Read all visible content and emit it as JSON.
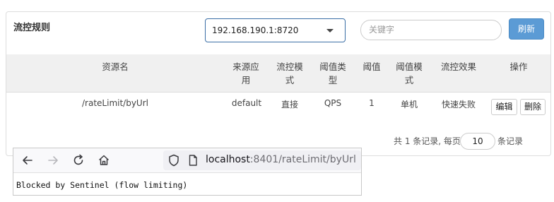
{
  "panel": {
    "title": "流控规则",
    "machine_select": "192.168.190.1:8720",
    "search_placeholder": "关键字",
    "refresh_label": "刷新"
  },
  "table": {
    "headers": [
      "资源名",
      "来源应用",
      "流控模式",
      "阈值类型",
      "阈值",
      "阈值模式",
      "流控效果",
      "操作"
    ],
    "headers_wrapped": {
      "source_app": [
        "来源应",
        "用"
      ],
      "flow_mode": [
        "流控模",
        "式"
      ],
      "threshold_type": [
        "阈值类",
        "型"
      ],
      "threshold_mode": [
        "阈值模",
        "式"
      ]
    },
    "rows": [
      {
        "resource": "/rateLimit/byUrl",
        "source_app": "default",
        "flow_mode": "直接",
        "threshold_type": "QPS",
        "threshold": "1",
        "threshold_mode": "单机",
        "effect": "快速失败",
        "edit_label": "编辑",
        "delete_label": "删除"
      }
    ]
  },
  "pagination": {
    "summary": "共 1 条记录, 每页",
    "page_size": "10",
    "suffix": "条记录"
  },
  "browser": {
    "url_host": "localhost",
    "url_rest": ":8401/rateLimit/byUrl",
    "body_text": "Blocked by Sentinel (flow limiting)",
    "icons": [
      "back-icon",
      "forward-icon",
      "reload-icon",
      "home-icon",
      "shield-icon",
      "page-icon"
    ]
  }
}
